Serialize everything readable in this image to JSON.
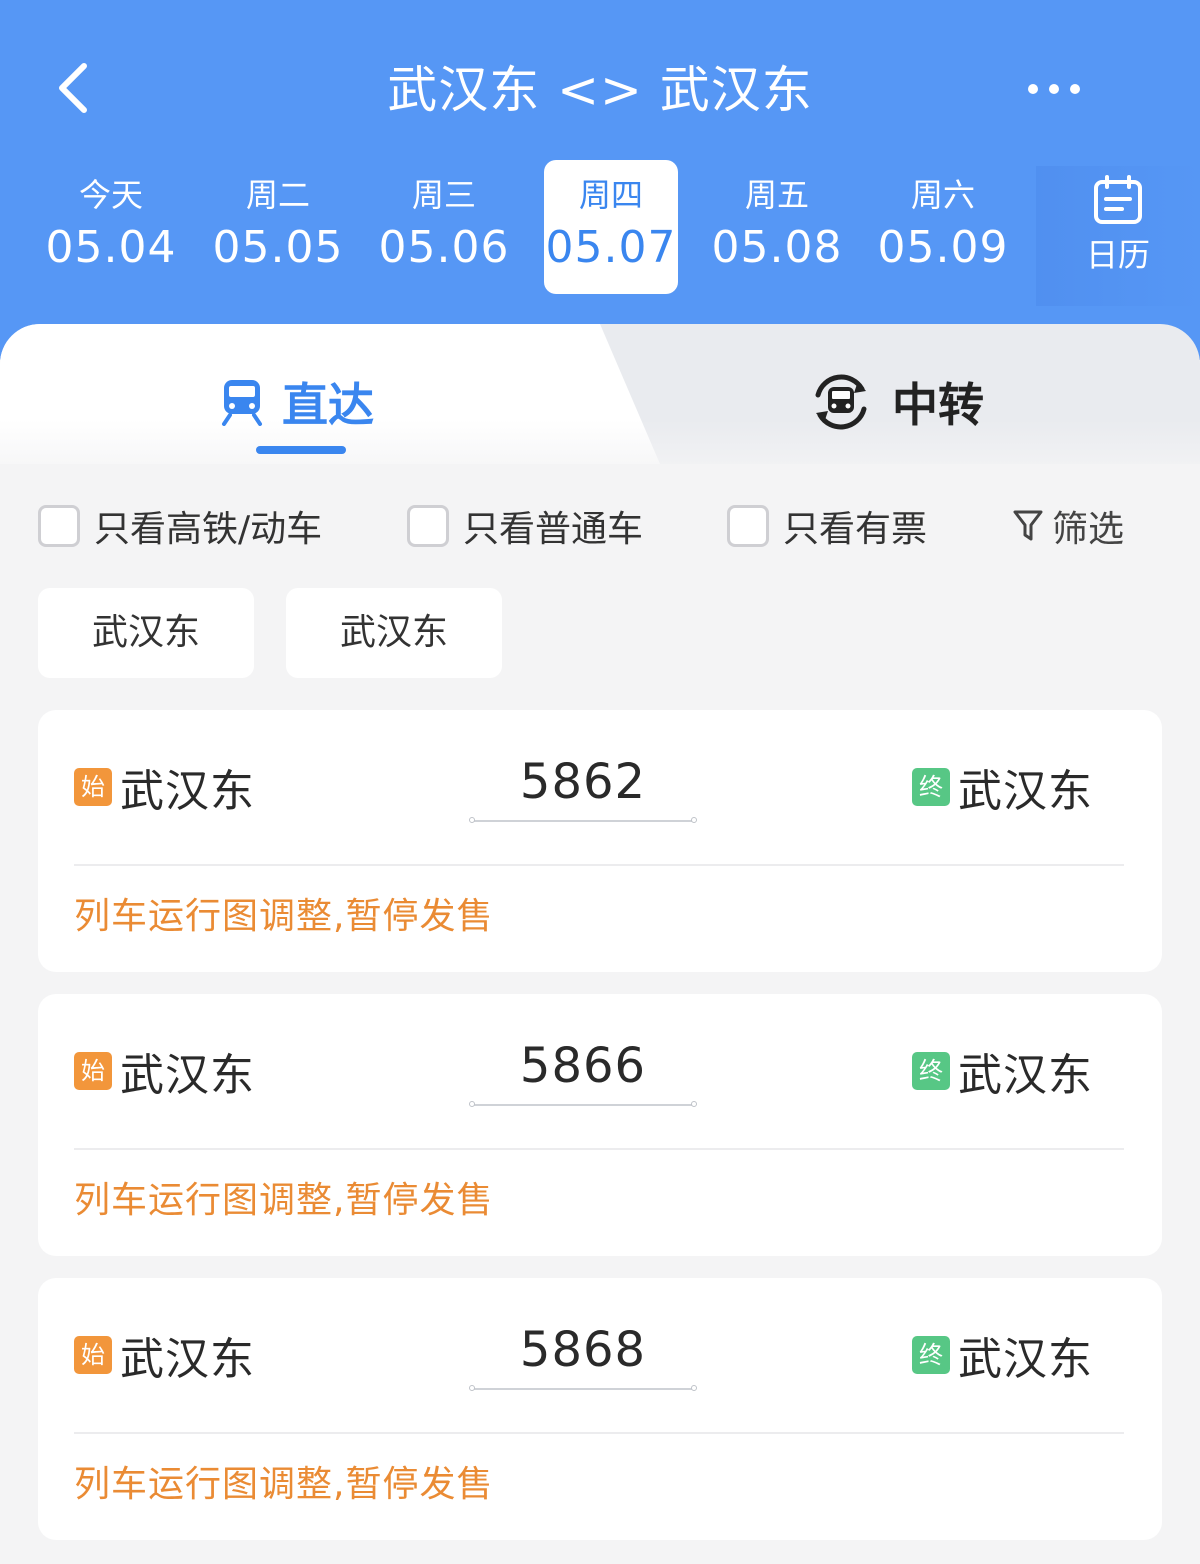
{
  "header": {
    "title": "武汉东 <> 武汉东",
    "back_icon": "chevron-left-icon",
    "more_icon": "more-horizontal-icon"
  },
  "dates": [
    {
      "dow": "今天",
      "date": "05.04",
      "active": false
    },
    {
      "dow": "周二",
      "date": "05.05",
      "active": false
    },
    {
      "dow": "周三",
      "date": "05.06",
      "active": false
    },
    {
      "dow": "周四",
      "date": "05.07",
      "active": true
    },
    {
      "dow": "周五",
      "date": "05.08",
      "active": false
    },
    {
      "dow": "周六",
      "date": "05.09",
      "active": false
    }
  ],
  "calendar": {
    "label": "日历",
    "icon": "calendar-icon"
  },
  "modes": {
    "direct": {
      "label": "直达",
      "icon": "train-icon",
      "active": true
    },
    "transfer": {
      "label": "中转",
      "icon": "transfer-train-icon",
      "active": false
    }
  },
  "filters": {
    "high_speed": "只看高铁/动车",
    "normal": "只看普通车",
    "has_ticket": "只看有票",
    "screen": "筛选",
    "screen_icon": "filter-icon"
  },
  "station_chips": [
    "武汉东",
    "武汉东"
  ],
  "trains": [
    {
      "start_tag": "始",
      "from": "武汉东",
      "number": "5862",
      "end_tag": "终",
      "to": "武汉东",
      "notice": "列车运行图调整,暂停发售"
    },
    {
      "start_tag": "始",
      "from": "武汉东",
      "number": "5866",
      "end_tag": "终",
      "to": "武汉东",
      "notice": "列车运行图调整,暂停发售"
    },
    {
      "start_tag": "始",
      "from": "武汉东",
      "number": "5868",
      "end_tag": "终",
      "to": "武汉东",
      "notice": "列车运行图调整,暂停发售"
    }
  ],
  "colors": {
    "header_bg": "#5697f5",
    "accent": "#3a86ef",
    "notice": "#ea8b34",
    "start_tag": "#f2963b",
    "end_tag": "#57c785"
  }
}
